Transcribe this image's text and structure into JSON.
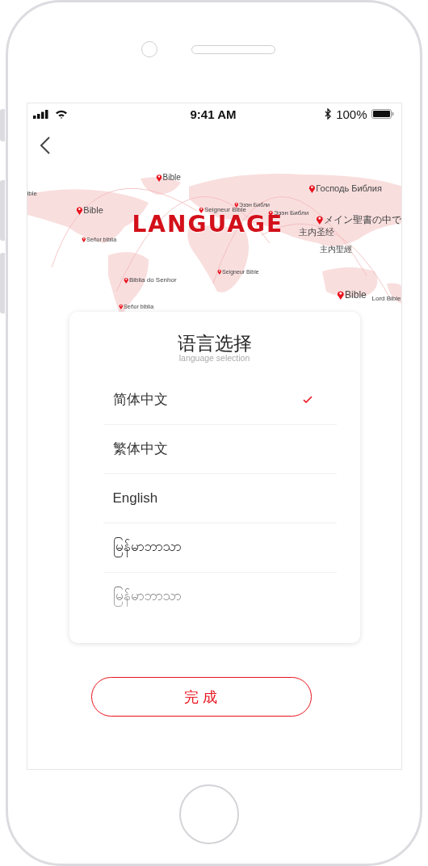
{
  "status_bar": {
    "time": "9:41 AM",
    "battery": "100%"
  },
  "map": {
    "title": "LANGUAGE",
    "labels": [
      {
        "text": "ible",
        "pin": false
      },
      {
        "text": "Bible",
        "pin": true
      },
      {
        "text": "Господь Библия",
        "pin": true
      },
      {
        "text": "Bible",
        "pin": true
      },
      {
        "text": "Seigneur Bible",
        "pin": true
      },
      {
        "text": "Эзэн Библи",
        "pin": true
      },
      {
        "text": "Эзэн Библи",
        "pin": true
      },
      {
        "text": "メイン聖書の中で",
        "pin": true
      },
      {
        "text": "主内圣经",
        "pin": false
      },
      {
        "text": "Señor biblia",
        "pin": true
      },
      {
        "text": "主内聖經",
        "pin": false
      },
      {
        "text": "Seigneur Bible",
        "pin": true
      },
      {
        "text": "Biblia do Senhor",
        "pin": true
      },
      {
        "text": "Señor biblia",
        "pin": true
      },
      {
        "text": "Bible",
        "pin": true
      },
      {
        "text": "Lord Bible",
        "pin": false
      }
    ]
  },
  "card": {
    "title": "语言选择",
    "subtitle": "language selection",
    "languages": [
      {
        "label": "简体中文",
        "selected": true
      },
      {
        "label": "繁体中文",
        "selected": false
      },
      {
        "label": "English",
        "selected": false
      },
      {
        "label": "မြန်မာဘာသာ",
        "selected": false
      },
      {
        "label": "မြန်မာဘာသာ",
        "selected": false
      }
    ]
  },
  "done_button": "完 成"
}
